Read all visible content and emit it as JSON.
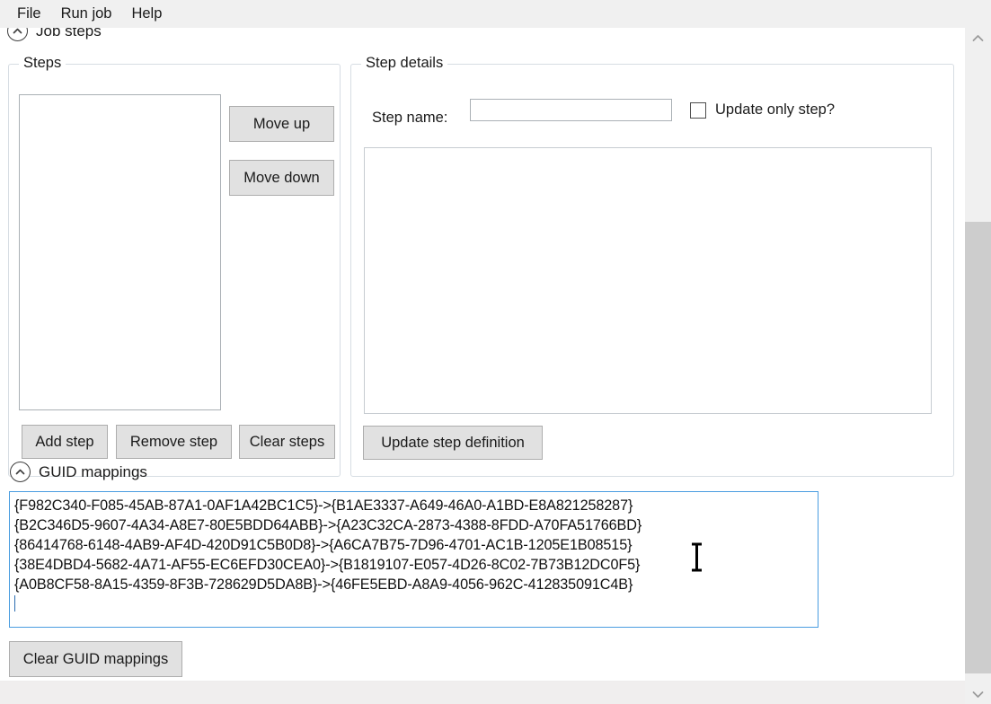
{
  "window": {
    "scrollbar": {
      "up_arrow": "chevron-up",
      "down_arrow": "chevron-down"
    }
  },
  "menubar": {
    "items": [
      {
        "label": "File"
      },
      {
        "label": "Run job"
      },
      {
        "label": "Help"
      }
    ]
  },
  "sections": {
    "job_steps": {
      "label": "Job steps",
      "expanded": true,
      "icon": "chevron-up-circle-icon"
    },
    "guid_mappings": {
      "label": "GUID mappings",
      "expanded": true,
      "icon": "chevron-up-circle-icon"
    }
  },
  "steps_group": {
    "legend": "Steps",
    "listbox_value": "",
    "buttons": {
      "move_up": "Move up",
      "move_down": "Move down",
      "add_step": "Add step",
      "remove_step": "Remove step",
      "clear_steps": "Clear steps"
    }
  },
  "step_details_group": {
    "legend": "Step details",
    "step_name_label": "Step name:",
    "step_name_value": "",
    "step_name_placeholder": "",
    "update_only_step": {
      "label": "Update only step?",
      "checked": false
    },
    "definition_value": "",
    "update_button": "Update step definition"
  },
  "guid_mappings": {
    "lines": [
      "{F982C340-F085-45AB-87A1-0AF1A42BC1C5}->{B1AE3337-A649-46A0-A1BD-E8A821258287}",
      "{B2C346D5-9607-4A34-A8E7-80E5BDD64ABB}->{A23C32CA-2873-4388-8FDD-A70FA51766BD}",
      "{86414768-6148-4AB9-AF4D-420D91C5B0D8}->{A6CA7B75-7D96-4701-AC1B-1205E1B08515}",
      "{38E4DBD4-5682-4A71-AF55-EC6EFD30CEA0}->{B1819107-E057-4D26-8C02-7B73B12DC0F5}",
      "{A0B8CF58-8A15-4359-8F3B-728629D5DA8B}->{46FE5EBD-A8A9-4056-962C-412835091C4B}"
    ],
    "clear_button": "Clear GUID mappings",
    "focused": true
  },
  "colors": {
    "focus_border": "#4a9de0",
    "button_face": "#e1e1e1",
    "button_border": "#adadad",
    "groupbox_border": "#d6dde3",
    "menubar_bg": "#f0f0f0",
    "scrollbar_track": "#f0f0f0",
    "scrollbar_thumb": "#cdcdcd",
    "text": "#1a1a1a"
  }
}
